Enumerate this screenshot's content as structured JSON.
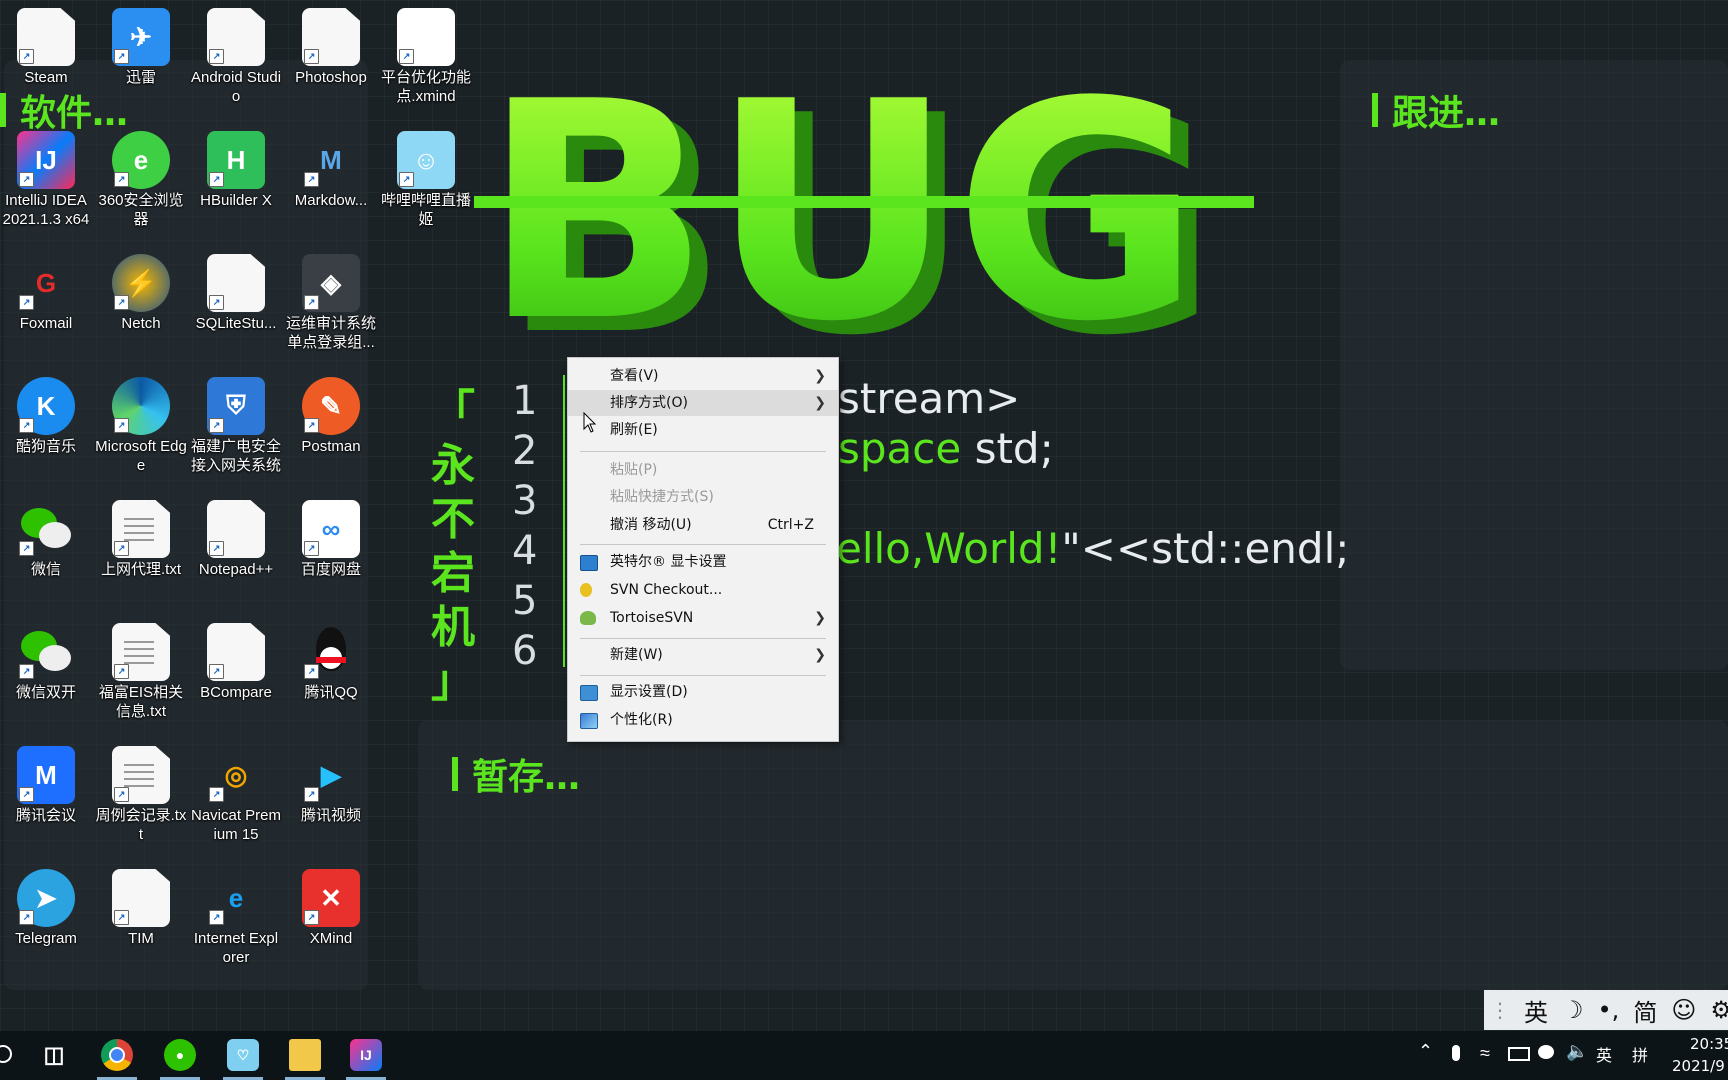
{
  "panels": {
    "software_title": "软件…",
    "follow_title": "跟进…",
    "staging_title": "暂存…"
  },
  "wallpaper": {
    "bug_text": "BUG",
    "vertical_text": [
      "「",
      "永",
      "不",
      "宕",
      "机",
      "」"
    ],
    "line_numbers": [
      "1",
      "2",
      "3",
      "4",
      "5",
      "6"
    ],
    "code_line1": "stream>",
    "code_line2_kw": "space",
    "code_line2_rest": " std;",
    "code_line4_str": "ello,World!",
    "code_line4_q": "\"",
    "code_line4_rest": "<<std::endl;"
  },
  "colors": {
    "accent": "#5be51e",
    "menu_bg": "#f2f2f2"
  },
  "desktop_icons": [
    {
      "label": "Steam",
      "icon": "doc-icon"
    },
    {
      "label": "迅雷",
      "icon": "xunlei-bird-icon"
    },
    {
      "label": "Android Studio",
      "icon": "doc-icon"
    },
    {
      "label": "Photoshop",
      "icon": "doc-icon"
    },
    {
      "label": "平台优化功能点.xmind",
      "icon": "xmind-file-icon"
    },
    {
      "label": "IntelliJ IDEA 2021.1.3 x64",
      "icon": "intellij-icon"
    },
    {
      "label": "360安全浏览器",
      "icon": "browser-360-icon"
    },
    {
      "label": "HBuilder X",
      "icon": "hbuilder-icon"
    },
    {
      "label": "Markdow...",
      "icon": "markdown-icon"
    },
    {
      "label": "哔哩哔哩直播姬",
      "icon": "bilibili-live-icon"
    },
    {
      "label": "Foxmail",
      "icon": "foxmail-icon"
    },
    {
      "label": "Netch",
      "icon": "netch-icon"
    },
    {
      "label": "SQLiteStu...",
      "icon": "doc-icon"
    },
    {
      "label": "运维审计系统单点登录组...",
      "icon": "shield-icon"
    },
    {
      "label": "酷狗音乐",
      "icon": "kugou-icon"
    },
    {
      "label": "Microsoft Edge",
      "icon": "edge-icon"
    },
    {
      "label": "福建广电安全接入网关系统",
      "icon": "gateway-icon"
    },
    {
      "label": "Postman",
      "icon": "postman-icon"
    },
    {
      "label": "微信",
      "icon": "wechat-icon"
    },
    {
      "label": "上网代理.txt",
      "icon": "txt-icon"
    },
    {
      "label": "Notepad++",
      "icon": "doc-icon"
    },
    {
      "label": "百度网盘",
      "icon": "baidu-netdisk-icon"
    },
    {
      "label": "微信双开",
      "icon": "wechat-icon"
    },
    {
      "label": "福富EIS相关信息.txt",
      "icon": "txt-icon"
    },
    {
      "label": "BCompare",
      "icon": "doc-icon"
    },
    {
      "label": "腾讯QQ",
      "icon": "qq-icon"
    },
    {
      "label": "腾讯会议",
      "icon": "tencent-meeting-icon"
    },
    {
      "label": "周例会记录.txt",
      "icon": "txt-icon"
    },
    {
      "label": "Navicat Premium 15",
      "icon": "navicat-icon"
    },
    {
      "label": "腾讯视频",
      "icon": "tencent-video-icon"
    },
    {
      "label": "Telegram",
      "icon": "telegram-icon"
    },
    {
      "label": "TIM",
      "icon": "doc-icon"
    },
    {
      "label": "Internet Explorer",
      "icon": "ie-icon"
    },
    {
      "label": "XMind",
      "icon": "xmind-icon"
    }
  ],
  "context_menu": {
    "view": "查看(V)",
    "sort": "排序方式(O)",
    "refresh": "刷新(E)",
    "paste": "粘贴(P)",
    "paste_shortcut": "粘贴快捷方式(S)",
    "undo_move": "撤消 移动(U)",
    "undo_shortcut": "Ctrl+Z",
    "intel_graphics": "英特尔® 显卡设置",
    "svn_checkout": "SVN Checkout...",
    "tortoise": "TortoiseSVN",
    "new": "新建(W)",
    "display": "显示设置(D)",
    "personalize": "个性化(R)"
  },
  "ime_bar": [
    "英",
    "☽",
    "•,",
    "简",
    "☺",
    "⚙"
  ],
  "tray": {
    "lang": "英",
    "ime_mode": "拼",
    "time": "20:35",
    "date": "2021/9"
  }
}
